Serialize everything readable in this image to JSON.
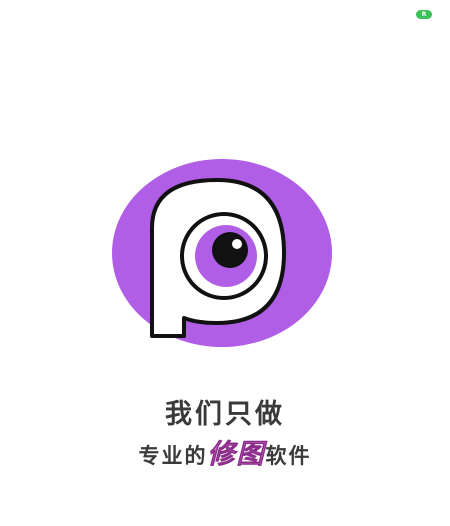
{
  "status_bar": {
    "badge_text": "R",
    "badge_color": "#3cc05a"
  },
  "splash": {
    "logo_icon": "purple-p-eye-logo",
    "logo_color": "#b15ee6",
    "slogan_main": "我们只做",
    "slogan_sub_prefix": "专业的",
    "slogan_sub_highlight": "修图",
    "slogan_sub_suffix": "软件",
    "highlight_color": "#e07bd8"
  }
}
